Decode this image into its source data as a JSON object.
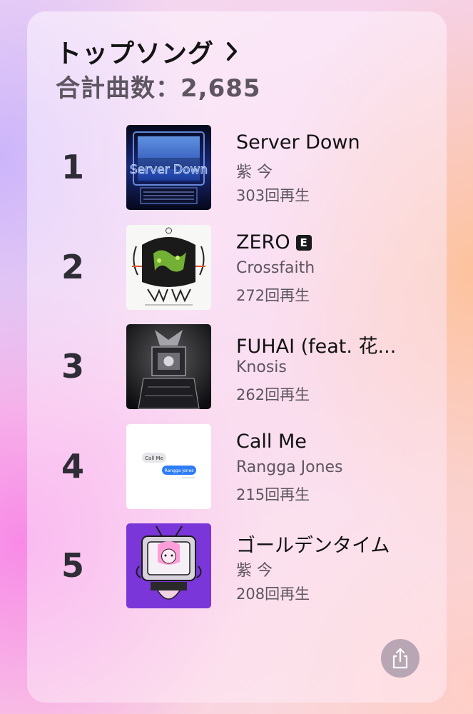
{
  "header": {
    "title": "トップソング",
    "total_label": "合計曲数：2,685"
  },
  "songs": [
    {
      "rank": "1",
      "title": "Server Down",
      "artist": "紫 今",
      "plays": "303回再生",
      "explicit": false,
      "art_text": "Server Down"
    },
    {
      "rank": "2",
      "title": "ZERO",
      "artist": "Crossfaith",
      "plays": "272回再生",
      "explicit": true,
      "explicit_badge": "E"
    },
    {
      "rank": "3",
      "title": "FUHAI (feat. 花...",
      "artist": "Knosis",
      "plays": "262回再生",
      "explicit": false
    },
    {
      "rank": "4",
      "title": "Call Me",
      "artist": "Rangga Jones",
      "plays": "215回再生",
      "explicit": false,
      "art_bubble_1": "Call Me",
      "art_bubble_2": "Rangga Jones"
    },
    {
      "rank": "5",
      "title": "ゴールデンタイム",
      "artist": "紫 今",
      "plays": "208回再生",
      "explicit": false
    }
  ],
  "icons": {
    "header_chevron": "chevron-right-icon",
    "share": "share-icon"
  },
  "colors": {
    "text_primary": "#141414",
    "text_secondary": "#5d5560",
    "share_button": "#b9a6b4"
  }
}
